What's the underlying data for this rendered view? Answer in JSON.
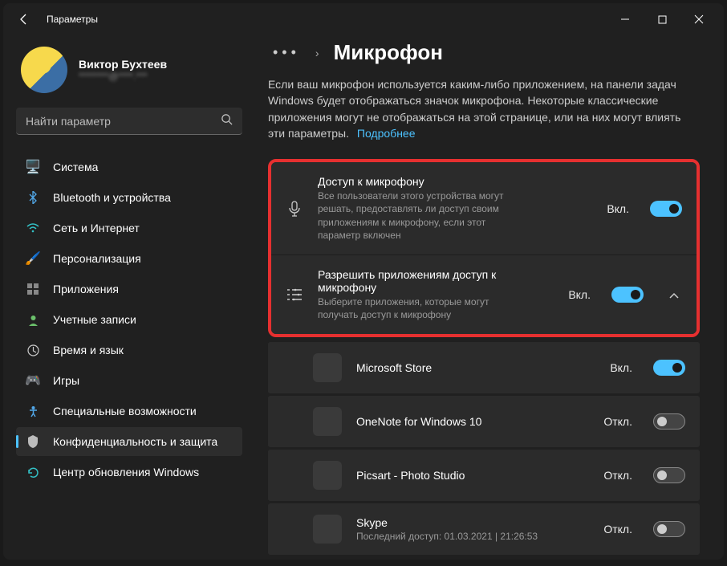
{
  "window": {
    "title": "Параметры"
  },
  "profile": {
    "name": "Виктор Бухтеев",
    "email": "********@****.***"
  },
  "search": {
    "placeholder": "Найти параметр"
  },
  "sidebar": {
    "items": [
      {
        "label": "Система"
      },
      {
        "label": "Bluetooth и устройства"
      },
      {
        "label": "Сеть и Интернет"
      },
      {
        "label": "Персонализация"
      },
      {
        "label": "Приложения"
      },
      {
        "label": "Учетные записи"
      },
      {
        "label": "Время и язык"
      },
      {
        "label": "Игры"
      },
      {
        "label": "Специальные возможности"
      },
      {
        "label": "Конфиденциальность и защита"
      },
      {
        "label": "Центр обновления Windows"
      }
    ]
  },
  "page": {
    "title": "Микрофон",
    "intro": "Если ваш микрофон используется каким-либо приложением, на панели задач Windows будет отображаться значок микрофона. Некоторые классические приложения могут не отображаться на этой странице, или на них могут влиять эти параметры.",
    "learn_more": "Подробнее"
  },
  "settings": {
    "access": {
      "title": "Доступ к микрофону",
      "desc": "Все пользователи этого устройства могут решать, предоставлять ли доступ своим приложениям к микрофону, если этот параметр включен",
      "state": "Вкл."
    },
    "allow_apps": {
      "title": "Разрешить приложениям доступ к микрофону",
      "desc": "Выберите приложения, которые могут получать доступ к микрофону",
      "state": "Вкл."
    }
  },
  "apps": [
    {
      "name": "Microsoft Store",
      "state": "Вкл.",
      "on": true
    },
    {
      "name": "OneNote for Windows 10",
      "state": "Откл.",
      "on": false
    },
    {
      "name": "Picsart - Photo Studio",
      "state": "Откл.",
      "on": false
    },
    {
      "name": "Skype",
      "sub": "Последний доступ: 01.03.2021  |  21:26:53",
      "state": "Откл.",
      "on": false
    }
  ]
}
